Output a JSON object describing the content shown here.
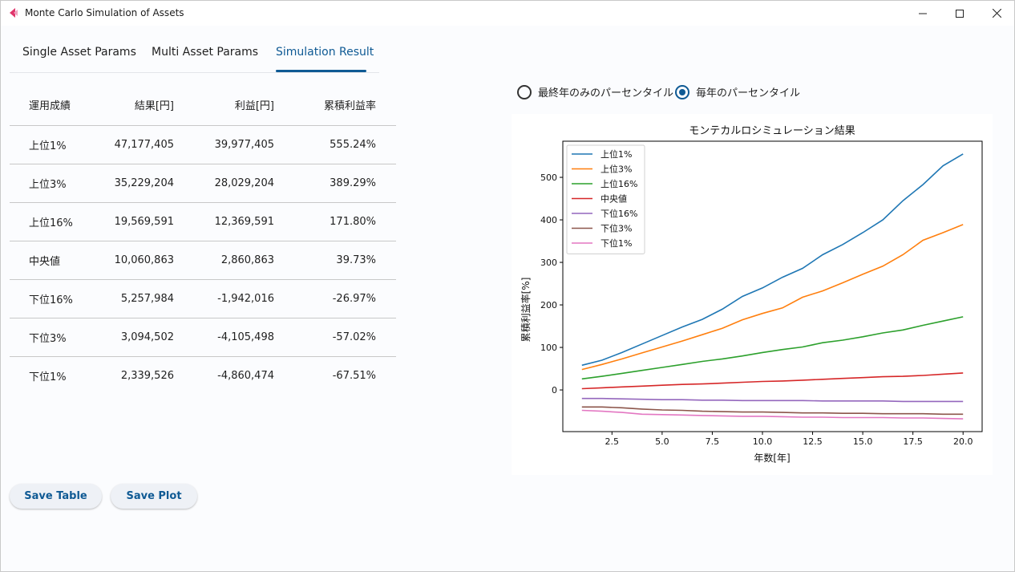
{
  "window": {
    "title": "Monte Carlo Simulation of Assets"
  },
  "tabs": [
    {
      "label": "Single Asset Params"
    },
    {
      "label": "Multi Asset Params"
    },
    {
      "label": "Simulation Result"
    }
  ],
  "table": {
    "headers": [
      "運用成績",
      "結果[円]",
      "利益[円]",
      "累積利益率"
    ],
    "rows": [
      [
        "上位1%",
        "47,177,405",
        "39,977,405",
        "555.24%"
      ],
      [
        "上位3%",
        "35,229,204",
        "28,029,204",
        "389.29%"
      ],
      [
        "上位16%",
        "19,569,591",
        "12,369,591",
        "171.80%"
      ],
      [
        "中央値",
        "10,060,863",
        "2,860,863",
        "39.73%"
      ],
      [
        "下位16%",
        "5,257,984",
        "-1,942,016",
        "-26.97%"
      ],
      [
        "下位3%",
        "3,094,502",
        "-4,105,498",
        "-57.02%"
      ],
      [
        "下位1%",
        "2,339,526",
        "-4,860,474",
        "-67.51%"
      ]
    ]
  },
  "buttons": {
    "save_table": "Save Table",
    "save_plot": "Save Plot"
  },
  "radio": {
    "option_a": "最終年のみのパーセンタイル",
    "option_b": "毎年のパーセンタイル",
    "selected": "option_b"
  },
  "colors": {
    "accent": "#0f5a94"
  },
  "chart_data": {
    "type": "line",
    "title": "モンテカルロシミュレーション結果",
    "xlabel": "年数[年]",
    "ylabel": "累積利益率[%]",
    "xlim": [
      0.05,
      20.95
    ],
    "ylim": [
      -98,
      585
    ],
    "xticks": [
      "2.5",
      "5.0",
      "7.5",
      "10.0",
      "12.5",
      "15.0",
      "17.5",
      "20.0"
    ],
    "xtick_values": [
      2.5,
      5,
      7.5,
      10,
      12.5,
      15,
      17.5,
      20
    ],
    "yticks": [
      "0",
      "100",
      "200",
      "300",
      "400",
      "500"
    ],
    "ytick_values": [
      0,
      100,
      200,
      300,
      400,
      500
    ],
    "grid": false,
    "legend": "upper-left",
    "x": [
      1,
      2,
      3,
      4,
      5,
      6,
      7,
      8,
      9,
      10,
      11,
      12,
      13,
      14,
      15,
      16,
      17,
      18,
      19,
      20
    ],
    "series": [
      {
        "name": "上位1%",
        "color": "#1f77b4",
        "values": [
          58,
          70,
          88,
          108,
          128,
          148,
          166,
          190,
          220,
          240,
          265,
          286,
          318,
          342,
          370,
          400,
          445,
          483,
          527,
          555
        ]
      },
      {
        "name": "上位3%",
        "color": "#ff7f0e",
        "values": [
          48,
          60,
          73,
          87,
          101,
          115,
          130,
          145,
          165,
          180,
          193,
          218,
          233,
          252,
          272,
          291,
          318,
          352,
          370,
          389
        ]
      },
      {
        "name": "上位16%",
        "color": "#2ca02c",
        "values": [
          26,
          32,
          39,
          46,
          53,
          60,
          67,
          73,
          80,
          88,
          95,
          101,
          111,
          117,
          125,
          134,
          141,
          152,
          162,
          172
        ]
      },
      {
        "name": "中央値",
        "color": "#d62728",
        "values": [
          3,
          5,
          7,
          9,
          11,
          13,
          14,
          16,
          18,
          20,
          21,
          23,
          25,
          27,
          29,
          31,
          32,
          34,
          37,
          40
        ]
      },
      {
        "name": "下位16%",
        "color": "#9467bd",
        "values": [
          -20,
          -20,
          -21,
          -22,
          -23,
          -23,
          -24,
          -24,
          -25,
          -25,
          -25,
          -25,
          -26,
          -26,
          -26,
          -26,
          -27,
          -27,
          -27,
          -27
        ]
      },
      {
        "name": "下位3%",
        "color": "#8c564b",
        "values": [
          -40,
          -40,
          -42,
          -45,
          -47,
          -48,
          -50,
          -51,
          -52,
          -52,
          -53,
          -54,
          -54,
          -55,
          -55,
          -56,
          -56,
          -56,
          -57,
          -57
        ]
      },
      {
        "name": "下位1%",
        "color": "#e377c2",
        "values": [
          -48,
          -50,
          -53,
          -57,
          -58,
          -59,
          -60,
          -61,
          -62,
          -62,
          -63,
          -64,
          -64,
          -65,
          -65,
          -65,
          -66,
          -66,
          -67,
          -68
        ]
      }
    ]
  }
}
